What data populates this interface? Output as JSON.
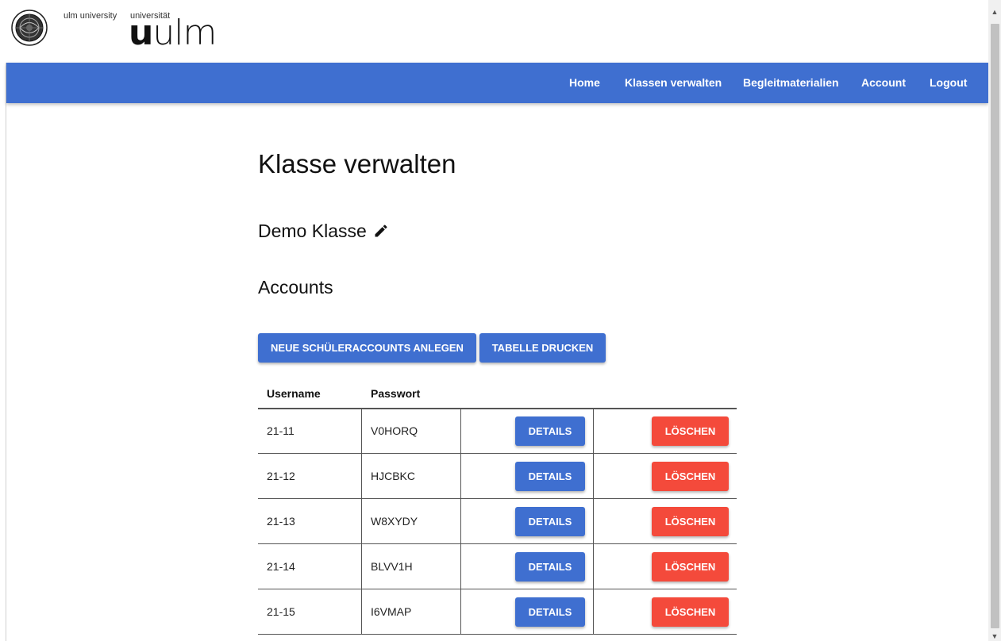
{
  "branding": {
    "tagline_left": "ulm university",
    "tagline_right": "universität",
    "wordmark_bold": "u",
    "wordmark_light": "ulm",
    "seal_icon": "university-seal-icon"
  },
  "nav": {
    "items": [
      {
        "label": "Home"
      },
      {
        "label": "Klassen verwalten"
      },
      {
        "label": "Begleitmaterialien"
      },
      {
        "label": "Account"
      },
      {
        "label": "Logout"
      }
    ],
    "color": "#3f6fd0"
  },
  "page": {
    "title": "Klasse verwalten",
    "class_name": "Demo Klasse",
    "edit_icon": "pencil-icon",
    "accounts_heading": "Accounts"
  },
  "actions": {
    "new_accounts_label": "NEUE SCHÜLERACCOUNTS ANLEGEN",
    "print_label": "TABELLE DRUCKEN"
  },
  "table": {
    "headers": {
      "username": "Username",
      "password": "Passwort"
    },
    "details_label": "DETAILS",
    "delete_label": "LÖSCHEN",
    "rows": [
      {
        "username": "21-11",
        "password": "V0HORQ"
      },
      {
        "username": "21-12",
        "password": "HJCBKC"
      },
      {
        "username": "21-13",
        "password": "W8XYDY"
      },
      {
        "username": "21-14",
        "password": "BLVV1H"
      },
      {
        "username": "21-15",
        "password": "I6VMAP"
      }
    ]
  },
  "colors": {
    "primary": "#3f6fd0",
    "danger": "#f44a3b"
  }
}
